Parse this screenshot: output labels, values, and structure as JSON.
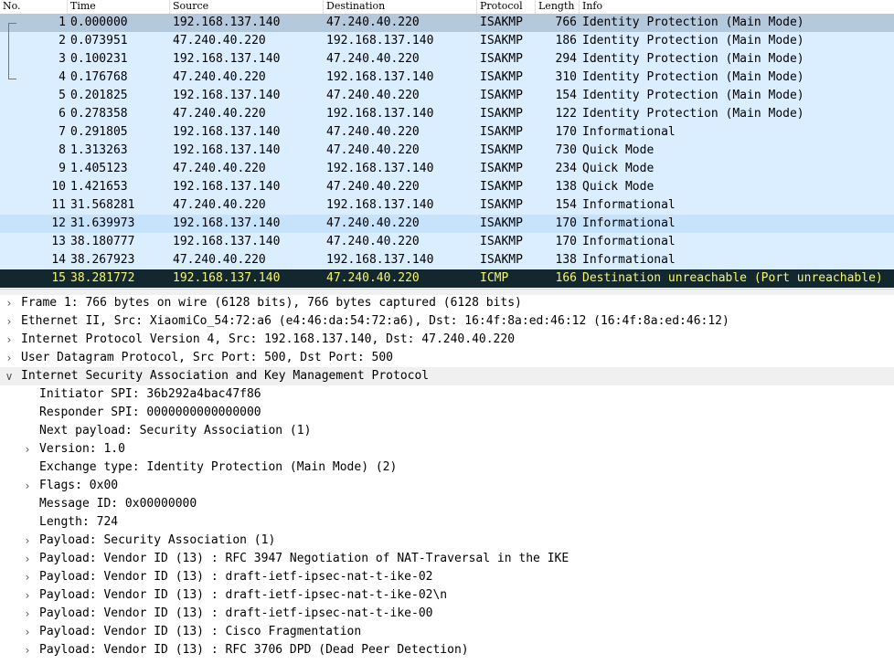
{
  "packet_list": {
    "columns": [
      "No.",
      "Time",
      "Source",
      "Destination",
      "Protocol",
      "Length",
      "Info"
    ],
    "rows": [
      {
        "no": "1",
        "time": "0.000000",
        "src": "192.168.137.140",
        "dst": "47.240.40.220",
        "proto": "ISAKMP",
        "len": "766",
        "info": "Identity Protection (Main Mode)",
        "state": "selected-inactive"
      },
      {
        "no": "2",
        "time": "0.073951",
        "src": "47.240.40.220",
        "dst": "192.168.137.140",
        "proto": "ISAKMP",
        "len": "186",
        "info": "Identity Protection (Main Mode)",
        "state": "normal"
      },
      {
        "no": "3",
        "time": "0.100231",
        "src": "192.168.137.140",
        "dst": "47.240.40.220",
        "proto": "ISAKMP",
        "len": "294",
        "info": "Identity Protection (Main Mode)",
        "state": "normal"
      },
      {
        "no": "4",
        "time": "0.176768",
        "src": "47.240.40.220",
        "dst": "192.168.137.140",
        "proto": "ISAKMP",
        "len": "310",
        "info": "Identity Protection (Main Mode)",
        "state": "normal"
      },
      {
        "no": "5",
        "time": "0.201825",
        "src": "192.168.137.140",
        "dst": "47.240.40.220",
        "proto": "ISAKMP",
        "len": "154",
        "info": "Identity Protection (Main Mode)",
        "state": "normal"
      },
      {
        "no": "6",
        "time": "0.278358",
        "src": "47.240.40.220",
        "dst": "192.168.137.140",
        "proto": "ISAKMP",
        "len": "122",
        "info": "Identity Protection (Main Mode)",
        "state": "normal"
      },
      {
        "no": "7",
        "time": "0.291805",
        "src": "192.168.137.140",
        "dst": "47.240.40.220",
        "proto": "ISAKMP",
        "len": "170",
        "info": "Informational",
        "state": "normal"
      },
      {
        "no": "8",
        "time": "1.313263",
        "src": "192.168.137.140",
        "dst": "47.240.40.220",
        "proto": "ISAKMP",
        "len": "730",
        "info": "Quick Mode",
        "state": "normal"
      },
      {
        "no": "9",
        "time": "1.405123",
        "src": "47.240.40.220",
        "dst": "192.168.137.140",
        "proto": "ISAKMP",
        "len": "234",
        "info": "Quick Mode",
        "state": "normal"
      },
      {
        "no": "10",
        "time": "1.421653",
        "src": "192.168.137.140",
        "dst": "47.240.40.220",
        "proto": "ISAKMP",
        "len": "138",
        "info": "Quick Mode",
        "state": "normal"
      },
      {
        "no": "11",
        "time": "31.568281",
        "src": "47.240.40.220",
        "dst": "192.168.137.140",
        "proto": "ISAKMP",
        "len": "154",
        "info": "Informational",
        "state": "normal"
      },
      {
        "no": "12",
        "time": "31.639973",
        "src": "192.168.137.140",
        "dst": "47.240.40.220",
        "proto": "ISAKMP",
        "len": "170",
        "info": "Informational",
        "state": "hover"
      },
      {
        "no": "13",
        "time": "38.180777",
        "src": "192.168.137.140",
        "dst": "47.240.40.220",
        "proto": "ISAKMP",
        "len": "170",
        "info": "Informational",
        "state": "normal"
      },
      {
        "no": "14",
        "time": "38.267923",
        "src": "47.240.40.220",
        "dst": "192.168.137.140",
        "proto": "ISAKMP",
        "len": "138",
        "info": "Informational",
        "state": "normal"
      },
      {
        "no": "15",
        "time": "38.281772",
        "src": "192.168.137.140",
        "dst": "47.240.40.220",
        "proto": "ICMP",
        "len": "166",
        "info": "Destination unreachable (Port unreachable)",
        "state": "error"
      }
    ]
  },
  "packet_details": {
    "lines": [
      {
        "text": "Frame 1: 766 bytes on wire (6128 bits), 766 bytes captured (6128 bits)",
        "level": 0,
        "expander": "collapsed"
      },
      {
        "text": "Ethernet II, Src: XiaomiCo_54:72:a6 (e4:46:da:54:72:a6), Dst: 16:4f:8a:ed:46:12 (16:4f:8a:ed:46:12)",
        "level": 0,
        "expander": "collapsed"
      },
      {
        "text": "Internet Protocol Version 4, Src: 192.168.137.140, Dst: 47.240.40.220",
        "level": 0,
        "expander": "collapsed"
      },
      {
        "text": "User Datagram Protocol, Src Port: 500, Dst Port: 500",
        "level": 0,
        "expander": "collapsed"
      },
      {
        "text": "Internet Security Association and Key Management Protocol",
        "level": 0,
        "expander": "expanded"
      },
      {
        "text": "Initiator SPI: 36b292a4bac47f86",
        "level": 1,
        "expander": "none"
      },
      {
        "text": "Responder SPI: 0000000000000000",
        "level": 1,
        "expander": "none"
      },
      {
        "text": "Next payload: Security Association (1)",
        "level": 1,
        "expander": "none"
      },
      {
        "text": "Version: 1.0",
        "level": 1,
        "expander": "collapsed"
      },
      {
        "text": "Exchange type: Identity Protection (Main Mode) (2)",
        "level": 1,
        "expander": "none"
      },
      {
        "text": "Flags: 0x00",
        "level": 1,
        "expander": "collapsed"
      },
      {
        "text": "Message ID: 0x00000000",
        "level": 1,
        "expander": "none"
      },
      {
        "text": "Length: 724",
        "level": 1,
        "expander": "none"
      },
      {
        "text": "Payload: Security Association (1)",
        "level": 1,
        "expander": "collapsed"
      },
      {
        "text": "Payload: Vendor ID (13) : RFC 3947 Negotiation of NAT-Traversal in the IKE",
        "level": 1,
        "expander": "collapsed"
      },
      {
        "text": "Payload: Vendor ID (13) : draft-ietf-ipsec-nat-t-ike-02",
        "level": 1,
        "expander": "collapsed"
      },
      {
        "text": "Payload: Vendor ID (13) : draft-ietf-ipsec-nat-t-ike-02\\n",
        "level": 1,
        "expander": "collapsed"
      },
      {
        "text": "Payload: Vendor ID (13) : draft-ietf-ipsec-nat-t-ike-00",
        "level": 1,
        "expander": "collapsed"
      },
      {
        "text": "Payload: Vendor ID (13) : Cisco Fragmentation",
        "level": 1,
        "expander": "collapsed"
      },
      {
        "text": "Payload: Vendor ID (13) : RFC 3706 DPD (Dead Peer Detection)",
        "level": 1,
        "expander": "collapsed"
      }
    ]
  },
  "icons": {
    "collapsed": "chevron-right-icon",
    "expanded": "chevron-down-icon"
  },
  "colors": {
    "row_bg": "#dbeeff",
    "row_selected_inactive": "#b5c9dd",
    "row_hover": "#c7e2fb",
    "row_error_bg": "#12272e",
    "row_error_fg": "#f7f76a",
    "detail_selected_bg": "#f0f0f0"
  }
}
